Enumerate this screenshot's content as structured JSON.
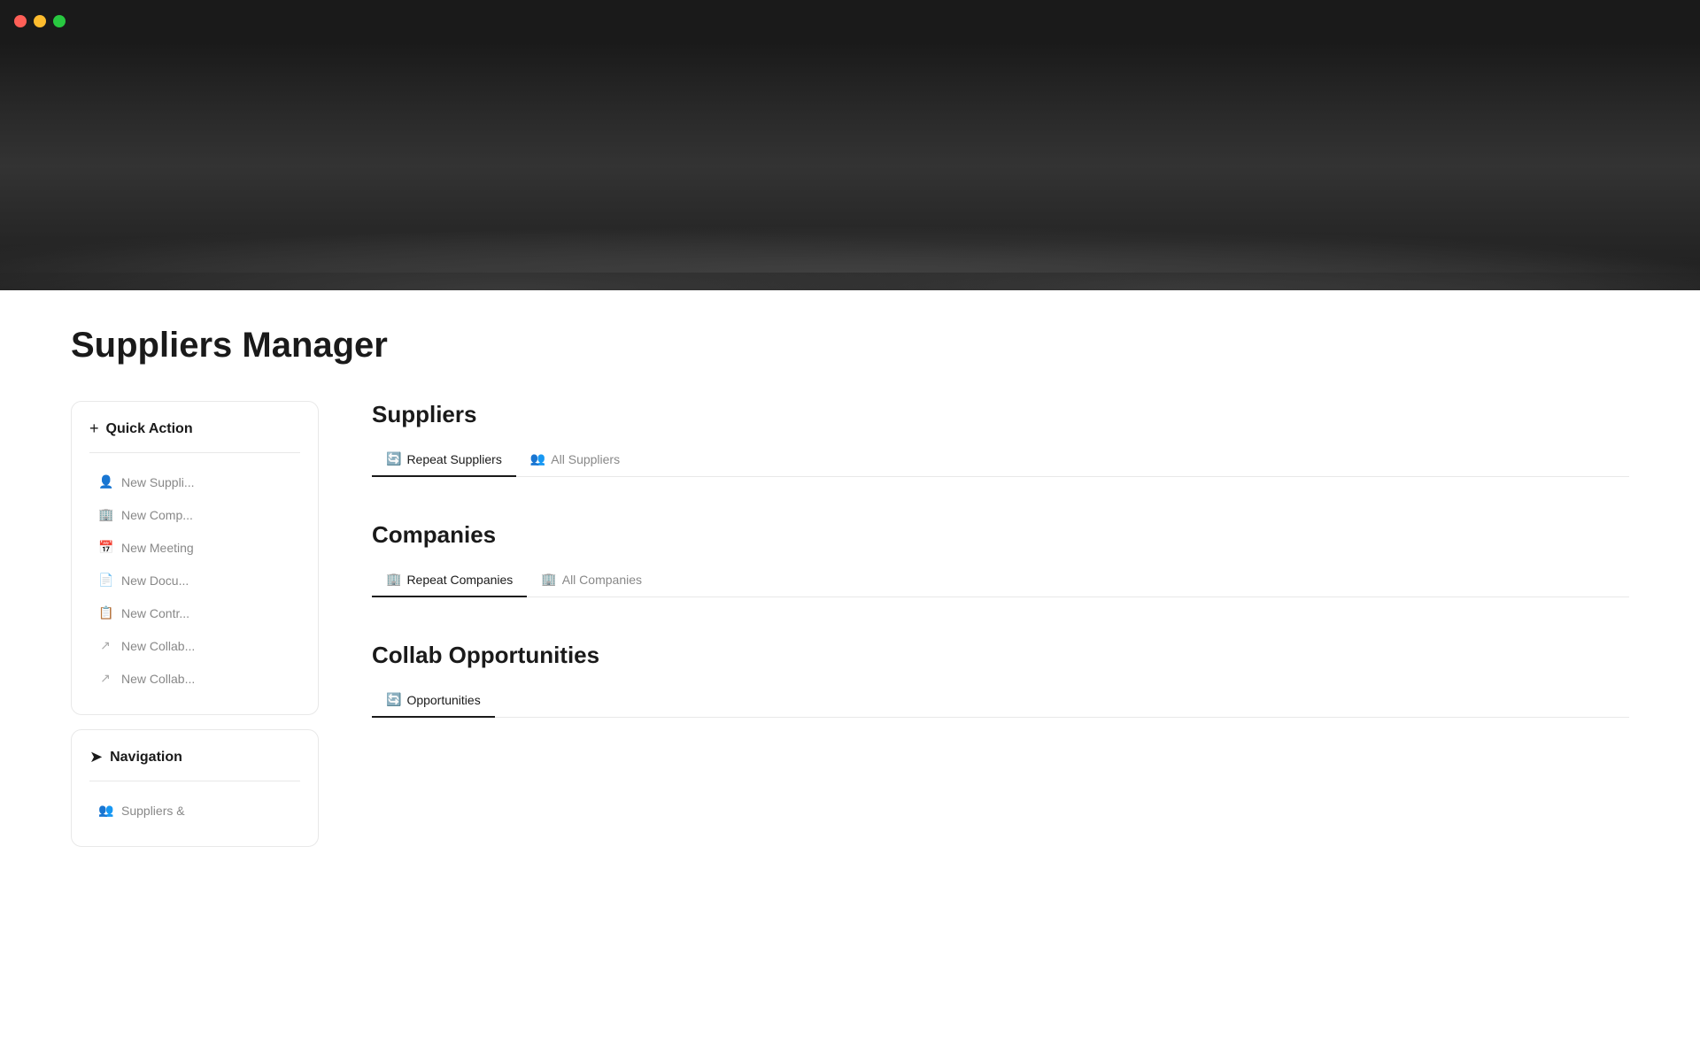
{
  "titlebar": {
    "traffic_close": "close",
    "traffic_minimize": "minimize",
    "traffic_maximize": "maximize"
  },
  "page": {
    "title": "Suppliers Manager"
  },
  "quick_action": {
    "title": "Quick Action",
    "icon": "+",
    "items": [
      {
        "id": "new-supplier",
        "label": "New Suppli...",
        "icon": "👤"
      },
      {
        "id": "new-company",
        "label": "New Comp...",
        "icon": "🏢"
      },
      {
        "id": "new-meeting",
        "label": "New Meeting",
        "icon": "📅"
      },
      {
        "id": "new-document",
        "label": "New Docu...",
        "icon": "📄"
      },
      {
        "id": "new-contract",
        "label": "New Contr...",
        "icon": "📋"
      },
      {
        "id": "new-collab1",
        "label": "New Collab...",
        "icon": "↗"
      },
      {
        "id": "new-collab2",
        "label": "New Collab...",
        "icon": "↗"
      }
    ]
  },
  "navigation": {
    "title": "Navigation",
    "icon": "➤",
    "items": [
      {
        "id": "suppliers-nav",
        "label": "Suppliers &",
        "icon": "👥"
      }
    ]
  },
  "suppliers_section": {
    "title": "Suppliers",
    "tabs": [
      {
        "id": "repeat-suppliers",
        "label": "Repeat Suppliers",
        "icon": "🔄",
        "active": true
      },
      {
        "id": "all-suppliers",
        "label": "All Suppliers",
        "icon": "👥",
        "active": false
      }
    ]
  },
  "companies_section": {
    "title": "Companies",
    "tabs": [
      {
        "id": "repeat-companies",
        "label": "Repeat Companies",
        "icon": "🏢",
        "active": true
      },
      {
        "id": "all-companies",
        "label": "All Companies",
        "icon": "🏢",
        "active": false
      }
    ]
  },
  "collab_section": {
    "title": "Collab Opportunities",
    "tabs": [
      {
        "id": "opportunities",
        "label": "Opportunities",
        "icon": "🔄",
        "active": true
      }
    ]
  }
}
